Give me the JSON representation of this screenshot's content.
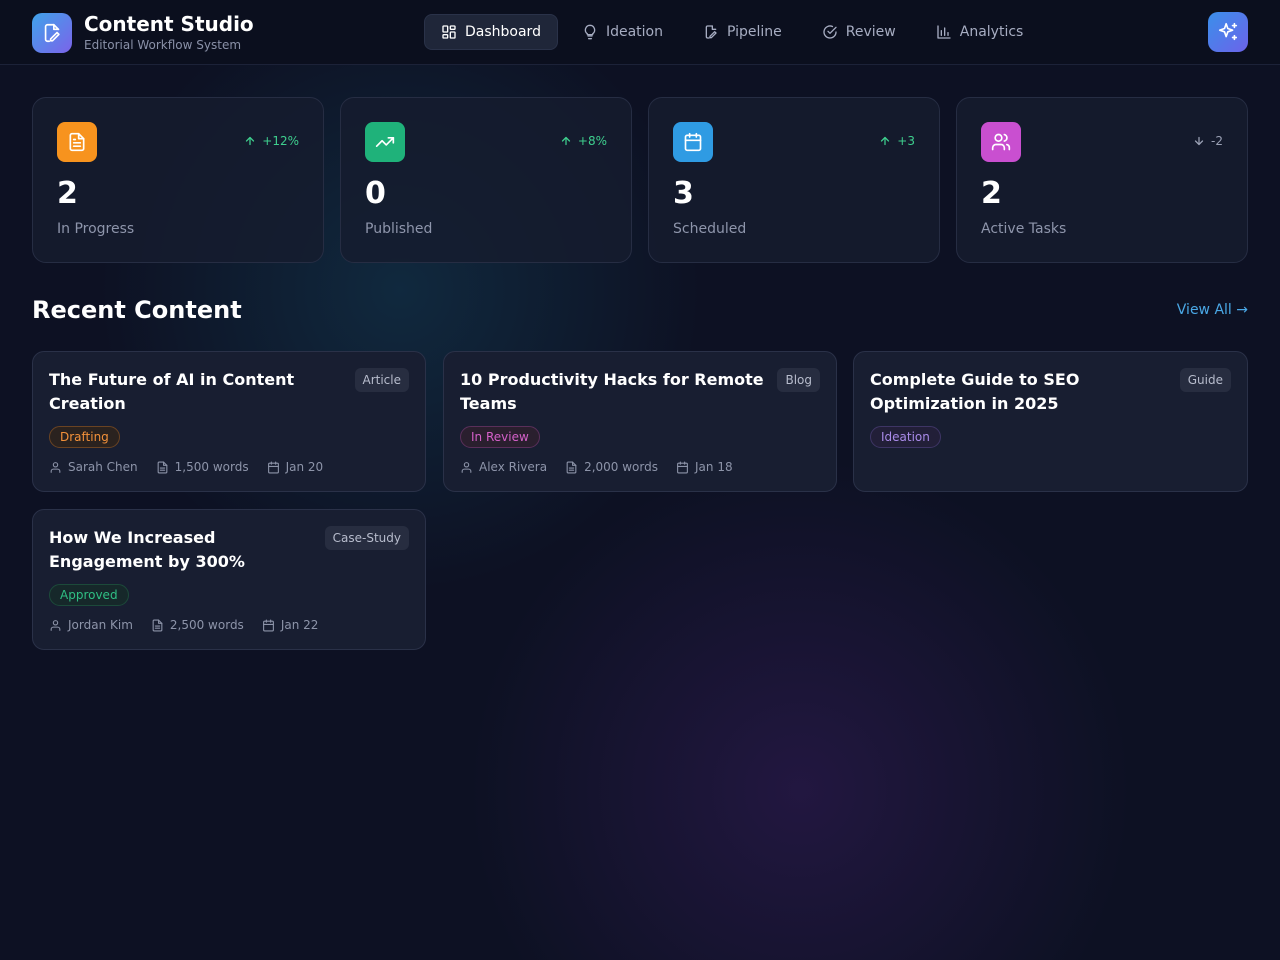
{
  "brand": {
    "title": "Content Studio",
    "subtitle": "Editorial Workflow System",
    "icon": "pen-document-icon"
  },
  "nav": {
    "items": [
      {
        "label": "Dashboard",
        "icon": "grid-icon",
        "active": true
      },
      {
        "label": "Ideation",
        "icon": "lightbulb-icon",
        "active": false
      },
      {
        "label": "Pipeline",
        "icon": "pen-document-icon",
        "active": false
      },
      {
        "label": "Review",
        "icon": "check-circle-icon",
        "active": false
      },
      {
        "label": "Analytics",
        "icon": "bar-chart-icon",
        "active": false
      }
    ]
  },
  "header_action": {
    "icon": "sparkles-icon"
  },
  "stats": [
    {
      "value": "2",
      "label": "In Progress",
      "trend": "+12%",
      "direction": "up",
      "icon": "document-icon",
      "color": "#f7931e",
      "trend_color": "#3ecf8e"
    },
    {
      "value": "0",
      "label": "Published",
      "trend": "+8%",
      "direction": "up",
      "icon": "trending-up-icon",
      "color": "#1fb27a",
      "trend_color": "#3ecf8e"
    },
    {
      "value": "3",
      "label": "Scheduled",
      "trend": "+3",
      "direction": "up",
      "icon": "calendar-icon",
      "color": "#2f9be3",
      "trend_color": "#3ecf8e"
    },
    {
      "value": "2",
      "label": "Active Tasks",
      "trend": "-2",
      "direction": "down",
      "icon": "users-icon",
      "color": "#c94fd0",
      "trend_color": "#9aa0b4"
    }
  ],
  "recent": {
    "title": "Recent Content",
    "view_all": "View All →",
    "items": [
      {
        "title": "The Future of AI in Content Creation",
        "type": "Article",
        "status": "Drafting",
        "status_color": "#f3913a",
        "author": "Sarah Chen",
        "words": "1,500 words",
        "date": "Jan 20"
      },
      {
        "title": "10 Productivity Hacks for Remote Teams",
        "type": "Blog",
        "status": "In Review",
        "status_color": "#d460c8",
        "author": "Alex Rivera",
        "words": "2,000 words",
        "date": "Jan 18"
      },
      {
        "title": "Complete Guide to SEO Optimization in 2025",
        "type": "Guide",
        "status": "Ideation",
        "status_color": "#a98ae8",
        "author": "",
        "words": "",
        "date": ""
      },
      {
        "title": "How We Increased Engagement by 300%",
        "type": "Case-Study",
        "status": "Approved",
        "status_color": "#2fbf84",
        "author": "Jordan Kim",
        "words": "2,500 words",
        "date": "Jan 22"
      }
    ]
  }
}
